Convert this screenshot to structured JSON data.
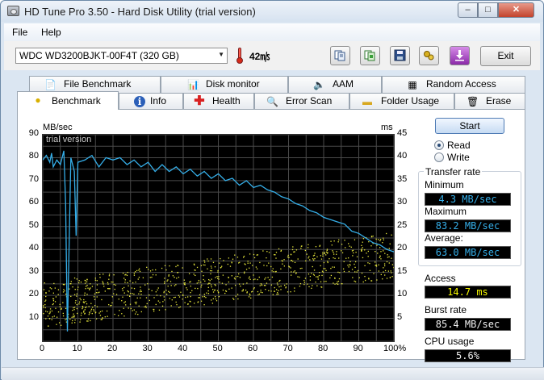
{
  "window": {
    "title": "HD Tune Pro 3.50 - Hard Disk Utility (trial version)",
    "minimize_glyph": "–",
    "maximize_glyph": "□",
    "close_glyph": "✕"
  },
  "menu": {
    "file": "File",
    "help": "Help"
  },
  "toolbar": {
    "drive": "WDC  WD3200BJKT-00F4T (320 GB)",
    "temperature": "42㎧",
    "exit_label": "Exit",
    "icons": [
      "copy-text-icon",
      "copy-screenshot-icon",
      "save-icon",
      "options-icon",
      "download-icon"
    ]
  },
  "tabs_row1": [
    {
      "label": "File Benchmark",
      "icon": "file-benchmark-icon"
    },
    {
      "label": "Disk monitor",
      "icon": "disk-monitor-icon"
    },
    {
      "label": "AAM",
      "icon": "speaker-icon"
    },
    {
      "label": "Random Access",
      "icon": "random-access-icon"
    }
  ],
  "tabs_row2": [
    {
      "label": "Benchmark",
      "icon": "lightbulb-icon",
      "active": true
    },
    {
      "label": "Info",
      "icon": "info-icon"
    },
    {
      "label": "Health",
      "icon": "health-cross-icon"
    },
    {
      "label": "Error Scan",
      "icon": "magnifier-icon"
    },
    {
      "label": "Folder Usage",
      "icon": "folder-icon"
    },
    {
      "label": "Erase",
      "icon": "trash-icon"
    }
  ],
  "controls": {
    "start_label": "Start",
    "read_label": "Read",
    "write_label": "Write",
    "mode_selected": "Read"
  },
  "stats": {
    "transfer_rate_label": "Transfer rate",
    "minimum_label": "Minimum",
    "minimum_value": "4.3 MB/sec",
    "maximum_label": "Maximum",
    "maximum_value": "83.2 MB/sec",
    "average_label": "Average:",
    "average_value": "63.0 MB/sec",
    "access_label": "Access",
    "access_value": "14.7 ms",
    "burst_label": "Burst rate",
    "burst_value": "85.4 MB/sec",
    "cpu_label": "CPU usage",
    "cpu_value": "5.6%"
  },
  "chart_data": {
    "type": "line",
    "watermark": "trial version",
    "y_left_label": "MB/sec",
    "y_right_label": "ms",
    "y_left_ticks": [
      "90",
      "80",
      "70",
      "60",
      "50",
      "40",
      "30",
      "20",
      "10"
    ],
    "y_right_ticks": [
      "45",
      "40",
      "35",
      "30",
      "25",
      "20",
      "15",
      "10",
      "5"
    ],
    "x_ticks": [
      "0",
      "10",
      "20",
      "30",
      "40",
      "50",
      "60",
      "70",
      "80",
      "90",
      "100%"
    ],
    "ylim_left": [
      0,
      90
    ],
    "ylim_right": [
      0,
      45
    ],
    "xlim": [
      0,
      100
    ],
    "grid": true,
    "colors": {
      "transfer": "#35aee8",
      "access": "#e8e83c",
      "grid": "#4a4a4a"
    },
    "series": [
      {
        "x": [
          0,
          1,
          2,
          2.5,
          3,
          4,
          5,
          6,
          6.5,
          7,
          8,
          9,
          9.5,
          10,
          12,
          14,
          16,
          18,
          20,
          22,
          24,
          26,
          28,
          30,
          32,
          34,
          36,
          38,
          40,
          42,
          44,
          46,
          48,
          50,
          52,
          54,
          56,
          58,
          60,
          62,
          64,
          66,
          68,
          70,
          72,
          74,
          76,
          78,
          80,
          82,
          84,
          86,
          88,
          90,
          92,
          94,
          96,
          98,
          100
        ],
        "values": [
          79,
          81,
          78,
          82,
          76,
          79,
          77,
          83,
          60,
          4.3,
          80,
          74,
          46,
          78,
          79,
          81,
          76,
          80,
          79,
          80,
          77,
          79,
          76,
          78,
          74,
          77,
          74,
          76,
          73,
          75,
          72,
          74,
          71,
          73,
          70,
          71,
          68,
          70,
          67,
          68,
          66,
          65,
          63,
          62,
          60,
          59,
          57,
          56,
          54,
          53,
          52,
          51,
          48,
          47,
          45,
          43,
          42,
          40,
          39
        ]
      },
      {
        "access_times_ms_min": 3,
        "access_times_ms_max": 27,
        "average_access_ms": 14.7
      }
    ]
  }
}
